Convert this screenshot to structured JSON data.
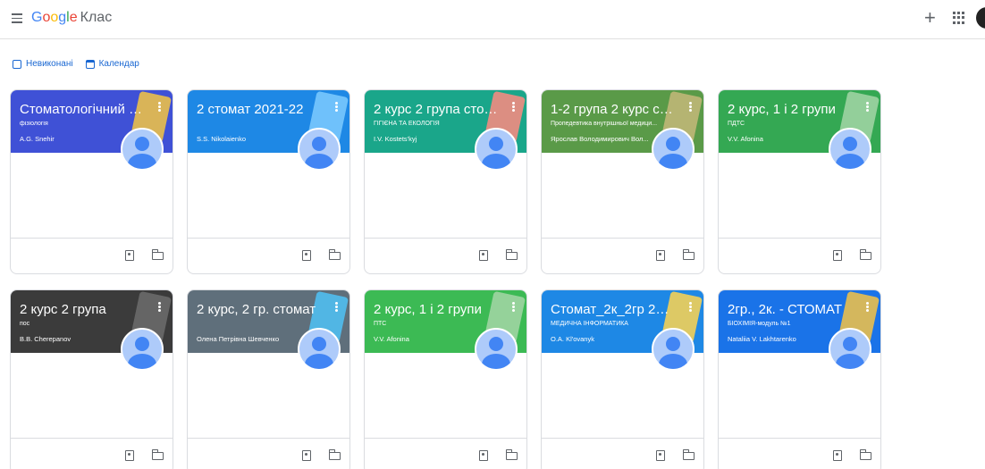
{
  "header": {
    "logo_parts": [
      "G",
      "o",
      "o",
      "g",
      "l",
      "e"
    ],
    "product": "Клас"
  },
  "subnav": {
    "todo_label": "Невиконані",
    "calendar_label": "Календар"
  },
  "cards": [
    {
      "title": "Стоматологічний фа...",
      "section": "фізіологія",
      "teacher": "A.G. Snehir",
      "color": "#3f51d6",
      "deco_color": "#f4c542"
    },
    {
      "title": "2 стомат 2021-22",
      "section": "",
      "teacher": "S.S. Nikolaienko",
      "color": "#1e88e5",
      "deco_color": "#7ecbff"
    },
    {
      "title": "2 курс 2 група стома...",
      "section": "ГІГІЄНА ТА ЕКОЛОГІЯ",
      "teacher": "I.V. Kostets'kyj",
      "color": "#1aa68a",
      "deco_color": "#ff8a80"
    },
    {
      "title": "1-2 група 2 курс сто...",
      "section": "Пропедевтика внутрішньої медици...",
      "teacher": "Ярослав Володимирович Вол...",
      "color": "#5a9a48",
      "deco_color": "#c5b87a"
    },
    {
      "title": "2 курс, 1 і 2 групи",
      "section": "ПДТС",
      "teacher": "V.V. Afonina",
      "color": "#34a853",
      "deco_color": "#a5d6a7"
    },
    {
      "title": "2 курс 2 група",
      "section": "пос",
      "teacher": "B.B. Cherepanov",
      "color": "#3b3b3b",
      "deco_color": "#6d6d6d"
    },
    {
      "title": "2 курс, 2 гр. стомат",
      "section": "",
      "teacher": "Олена Петрівна Шевченко",
      "color": "#5f6f7b",
      "deco_color": "#4fc3f7"
    },
    {
      "title": "2 курс, 1 і 2 групи",
      "section": "ПТС",
      "teacher": "V.V. Afonina",
      "color": "#3cba54",
      "deco_color": "#a5d6a7"
    },
    {
      "title": "Стомат_2к_2гр 2021",
      "section": "МЕДИЧНА ІНФОРМАТИКА",
      "teacher": "O.A. Kl'ovanyk",
      "color": "#1e88e5",
      "deco_color": "#ffd54f"
    },
    {
      "title": "2гр., 2к. - СТОМАТ",
      "section": "БІОХІМІЯ-модуль №1",
      "teacher": "Nataliia V. Lakhtarenko",
      "color": "#1a73e8",
      "deco_color": "#f6c344"
    }
  ]
}
